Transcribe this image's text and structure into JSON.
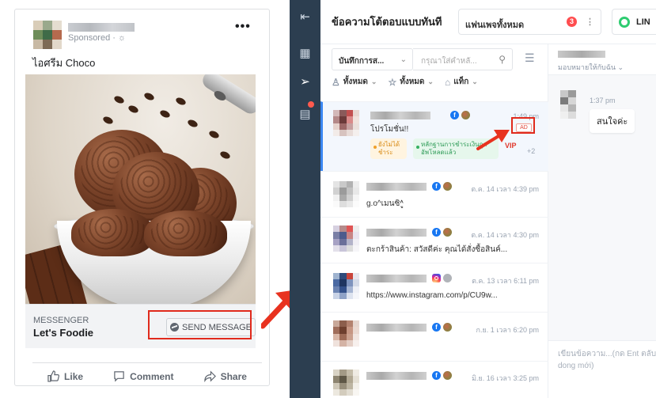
{
  "fb_ad": {
    "sponsored": "Sponsored · ☼",
    "more": "•••",
    "caption": "ไอศรีม Choco",
    "cta_source": "MESSENGER",
    "cta_title": "Let's Foodie",
    "send_button": "SEND MESSAGE",
    "actions": {
      "like": "Like",
      "comment": "Comment",
      "share": "Share"
    }
  },
  "app": {
    "title": "ข้อความโต้ตอบแบบทันที",
    "page_select": "แฟนเพจทั้งหมด",
    "page_badge": "3",
    "page_kebab": "⋮",
    "line_button": "LIN",
    "filter": {
      "selected": "บันทึกการส...",
      "search_placeholder": "กรุณาใส่คำหลั..."
    },
    "chips": {
      "people": "ทั้งหมด",
      "starred": "ทั้งหมด",
      "tags": "แท็ก"
    },
    "conversations": [
      {
        "time": "1:49 pm",
        "preview": "โปรโมชั่น!!",
        "ad_badge": "AD",
        "tags": [
          "ยังไม่ได้ชำระ",
          "หลักฐานการชำระเงินถูกอัพโหลดแล้ว"
        ],
        "vip": "VIP",
        "more": "+2"
      },
      {
        "time": "ต.ค. 14 เวลา 4:39 pm",
        "preview": "g.o^เมนซิ^ู"
      },
      {
        "time": "ต.ค. 14 เวลา 4:30 pm",
        "preview": "ตะกร้าสินค้า: สวัสดีค่ะ คุณได้สั่งซื้อสินค์..."
      },
      {
        "time": "ต.ค. 13 เวลา 6:11 pm",
        "preview": "https://www.instagram.com/p/CU9w..."
      },
      {
        "time": "ก.ย. 1 เวลา 6:20 pm",
        "preview": ""
      },
      {
        "time": "มิ.ย. 16 เวลา 3:25 pm",
        "preview": ""
      }
    ],
    "thread": {
      "assign": "มอบหมายให้กับฉัน",
      "message_time": "1:37 pm",
      "message_text": "สนใจค่ะ",
      "composer_placeholder": "เขียนข้อความ...(กด Enter เพื่อส่ง, Shift + Enter เพื่อขึ้นบรรทัดใหม่)",
      "composer_visible": "เขียนข้อความ...(กด Ent ตลับ dong mới)"
    },
    "colors": {
      "rail": "#2c3e50",
      "accent": "#3b87f2",
      "highlight": "#e02a1c"
    }
  }
}
